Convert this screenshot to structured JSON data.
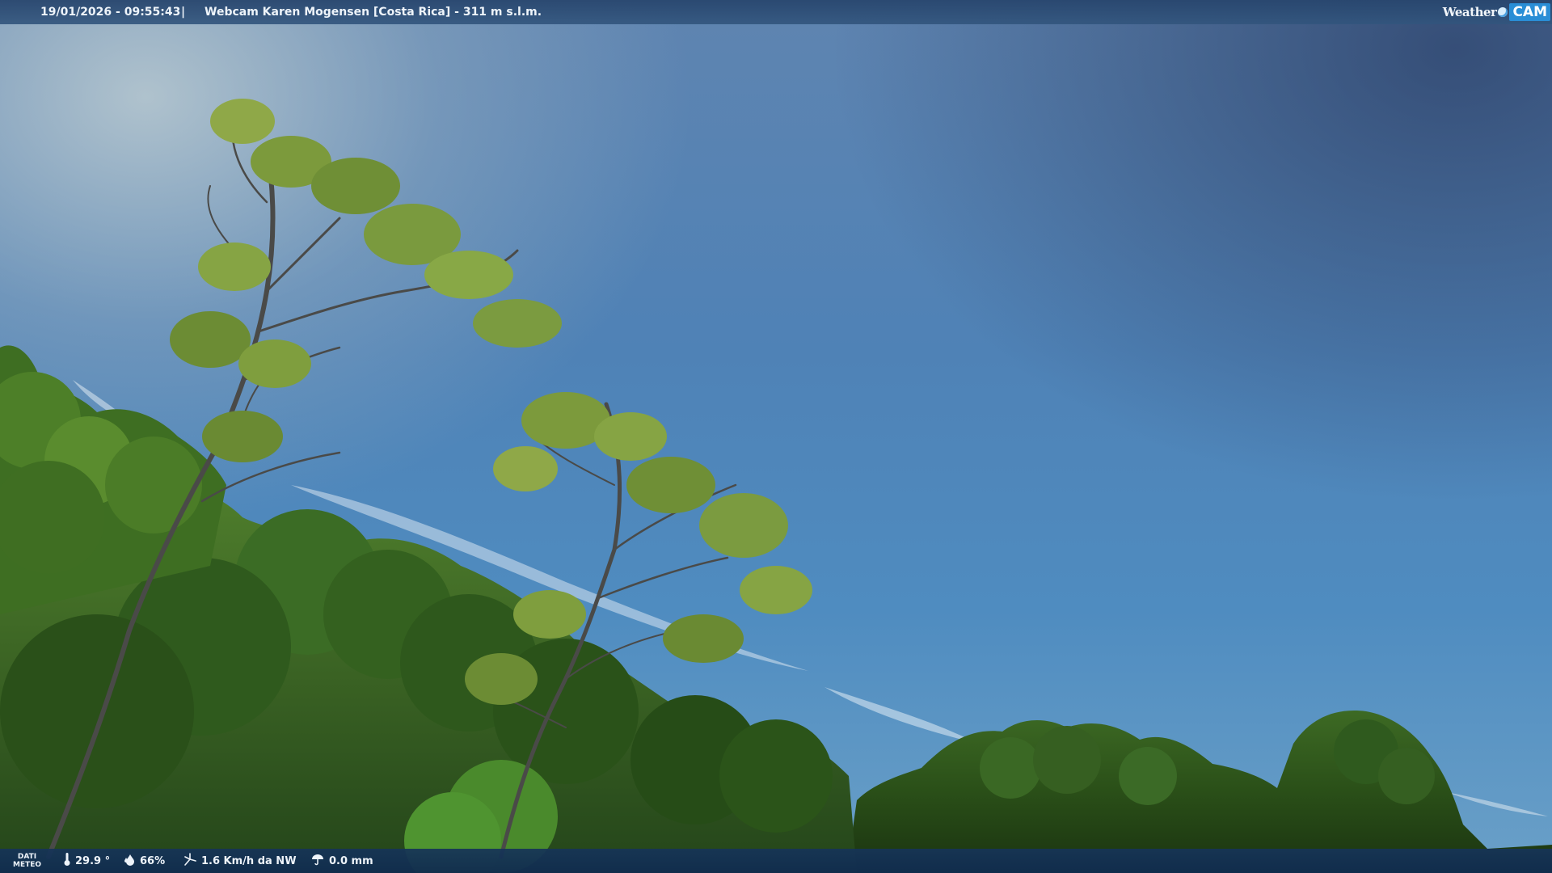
{
  "topbar": {
    "timestamp": "19/01/2026 - 09:55:43",
    "separator": "|",
    "title": "Webcam Karen Mogensen [Costa Rica] - 311 m s.l.m."
  },
  "logo": {
    "weather": "Weather",
    "cam": "CAM"
  },
  "weather_data": {
    "label_line1": "DATI",
    "label_line2": "METEO",
    "temperature": "29.9 °",
    "humidity": "66%",
    "wind": "1.6 Km/h da NW",
    "rain": "0.0 mm"
  },
  "icons": {
    "temperature": "thermometer-icon",
    "humidity": "droplet-icon",
    "wind": "wind-icon",
    "rain": "rain-gauge-icon"
  },
  "colors": {
    "bar_top": "#2e5688",
    "bar_bottom": "#143056",
    "logo_accent": "#2a8ed6"
  }
}
